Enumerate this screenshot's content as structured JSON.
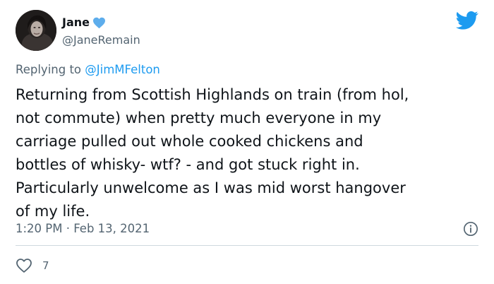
{
  "tweet": {
    "author": {
      "display_name": "Jane",
      "handle": "@JaneRemain",
      "badge_icon": "blue-heart-icon"
    },
    "platform_icon": "twitter-bird-icon",
    "reply": {
      "prefix": "Replying to ",
      "mention": "@JimMFelton"
    },
    "body_lines": [
      "Returning from Scottish Highlands on train (from hol,",
      "not commute) when pretty much everyone in my",
      "carriage pulled out whole cooked chickens and",
      "bottles of whisky- wtf? - and got stuck right in.",
      "Particularly unwelcome as I was mid worst hangover",
      "of my life."
    ],
    "timestamp": "1:20 PM · Feb 13, 2021",
    "info_icon": "info-icon",
    "like_icon": "heart-outline-icon",
    "likes": "7"
  },
  "colors": {
    "text": "#0f1419",
    "secondary": "#536471",
    "accent": "#1d9bf0",
    "divider": "#cfd9de"
  }
}
